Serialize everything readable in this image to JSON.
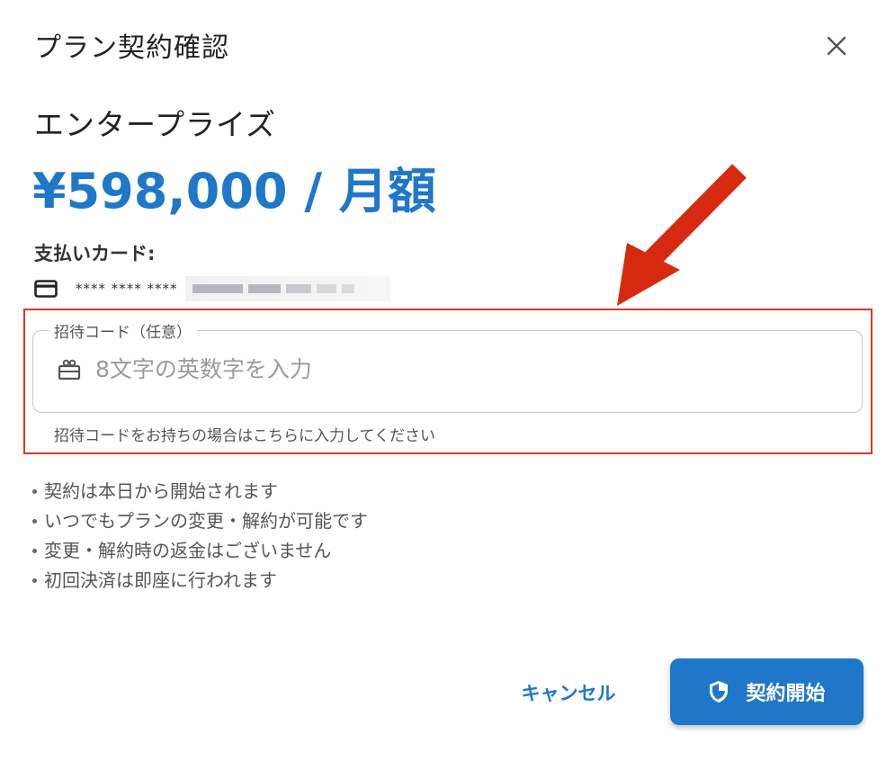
{
  "dialog": {
    "title": "プラン契約確認",
    "close_icon": "close-icon"
  },
  "plan": {
    "name": "エンタープライズ",
    "price": "¥598,000 / 月額"
  },
  "card": {
    "label": "支払いカード:",
    "icon": "credit-card-icon",
    "masked_number": "**** **** ****"
  },
  "invite": {
    "label": "招待コード（任意）",
    "icon": "gift-icon",
    "value": "",
    "placeholder": "8文字の英数字を入力",
    "helper": "招待コードをお持ちの場合はこちらに入力してください"
  },
  "notes": [
    "契約は本日から開始されます",
    "いつでもプランの変更・解約が可能です",
    "変更・解約時の返金はございません",
    "初回決済は即座に行われます"
  ],
  "actions": {
    "cancel_label": "キャンセル",
    "submit_label": "契約開始",
    "submit_icon": "shield-icon"
  },
  "colors": {
    "accent": "#1f77c9",
    "highlight": "#d93a1c",
    "arrow": "#d62a10"
  }
}
